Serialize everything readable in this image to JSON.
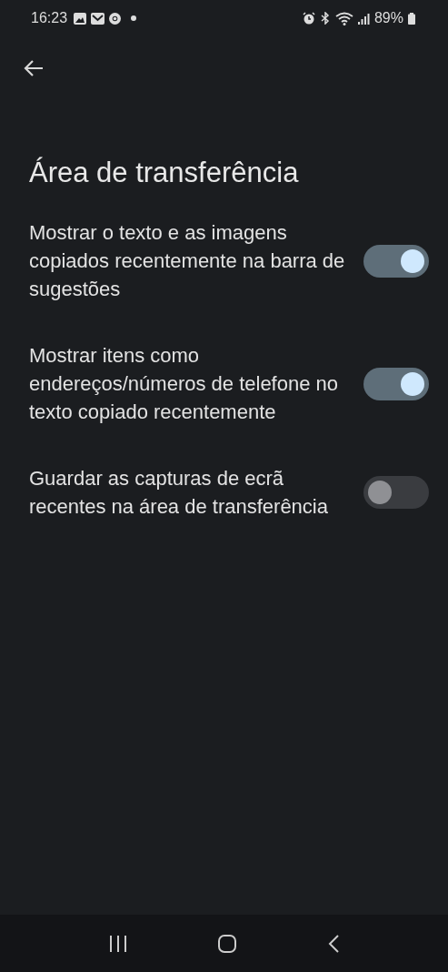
{
  "status_bar": {
    "time": "16:23",
    "battery": "89%"
  },
  "title": "Área de transferência",
  "settings": [
    {
      "label": "Mostrar o texto e as imagens copiados recentemente na barra de sugestões",
      "on": true
    },
    {
      "label": "Mostrar itens como endereços/números de telefone no texto copiado recentemente",
      "on": true
    },
    {
      "label": "Guardar as capturas de ecrã recentes na área de transferência",
      "on": false
    }
  ]
}
